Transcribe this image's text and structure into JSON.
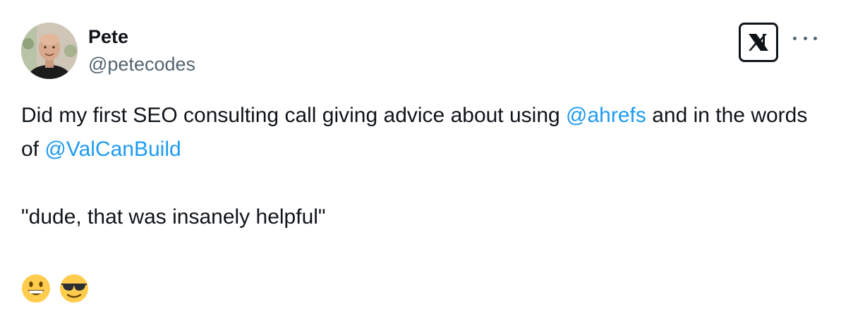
{
  "author": {
    "name": "Pete",
    "handle": "@petecodes"
  },
  "icons": {
    "avatar": "profile-photo",
    "logo": "x-logo-icon",
    "more": "more-horizontal-icon"
  },
  "tweet": {
    "line1_pre": "Did my first SEO consulting call giving advice about using ",
    "mention1": "@ahrefs",
    "line1_post": " and in the words of ",
    "mention2": "@ValCanBuild",
    "quote": "\"dude, that was insanely helpful\"",
    "emojis": [
      "grinning-face",
      "smiling-face-with-sunglasses"
    ]
  },
  "colors": {
    "mention": "#1d9bf0",
    "handle": "#536471",
    "text": "#0f1419"
  }
}
